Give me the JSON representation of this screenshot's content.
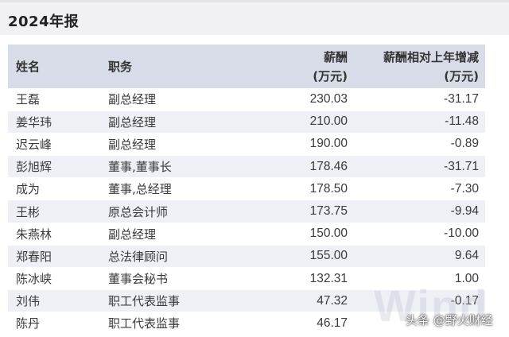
{
  "title": "2024年报",
  "table": {
    "headers": {
      "name": "姓名",
      "position": "职务",
      "salary_line1": "薪酬",
      "salary_line2": "(万元)",
      "change_line1": "薪酬相对上年增减",
      "change_line2": "(万元)"
    },
    "rows": [
      {
        "name": "王磊",
        "position": "副总经理",
        "salary": "230.03",
        "change": "-31.17"
      },
      {
        "name": "姜华玮",
        "position": "副总经理",
        "salary": "210.00",
        "change": "-11.48"
      },
      {
        "name": "迟云峰",
        "position": "副总经理",
        "salary": "190.00",
        "change": "-0.89"
      },
      {
        "name": "彭旭辉",
        "position": "董事,董事长",
        "salary": "178.46",
        "change": "-31.71"
      },
      {
        "name": "成为",
        "position": "董事,总经理",
        "salary": "178.50",
        "change": "-7.30"
      },
      {
        "name": "王彬",
        "position": "原总会计师",
        "salary": "173.75",
        "change": "-9.94"
      },
      {
        "name": "朱燕林",
        "position": "副总经理",
        "salary": "150.00",
        "change": "-10.00"
      },
      {
        "name": "郑春阳",
        "position": "总法律顾问",
        "salary": "155.00",
        "change": "9.64"
      },
      {
        "name": "陈冰峡",
        "position": "董事会秘书",
        "salary": "132.31",
        "change": "1.00"
      },
      {
        "name": "刘伟",
        "position": "职工代表监事",
        "salary": "47.32",
        "change": "-0.17"
      },
      {
        "name": "陈丹",
        "position": "职工代表监事",
        "salary": "46.17",
        "change": ""
      }
    ]
  },
  "watermark_text": "Wind",
  "source_tag": "头条 @野火财经",
  "colors": {
    "header_bg": "#d7dce8",
    "stripe_bg": "#eef0f6",
    "title_bar_bg": "#f1f1f3"
  }
}
